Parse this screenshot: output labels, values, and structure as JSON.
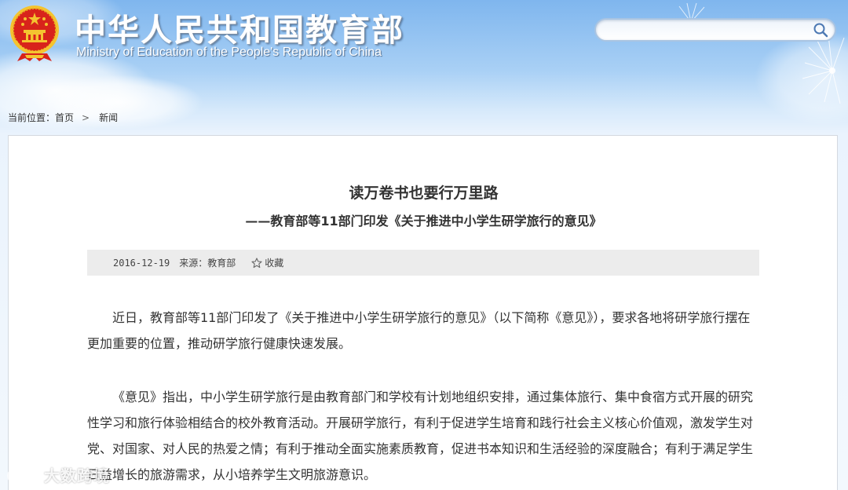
{
  "header": {
    "site_title": "中华人民共和国教育部",
    "site_subtitle": "Ministry of Education of the People's Republic of China",
    "search": {
      "value": "",
      "placeholder": ""
    }
  },
  "breadcrumb": {
    "prefix": "当前位置：",
    "home": "首页",
    "separator": ">",
    "current": "新闻"
  },
  "article": {
    "title": "读万卷书也要行万里路",
    "subtitle": "——教育部等11部门印发《关于推进中小学生研学旅行的意见》",
    "date": "2016-12-19",
    "source": "来源：教育部",
    "favorite_label": "收藏",
    "paragraphs": [
      "近日，教育部等11部门印发了《关于推进中小学生研学旅行的意见》（以下简称《意见》），要求各地将研学旅行摆在更加重要的位置，推动研学旅行健康快速发展。",
      "《意见》指出，中小学生研学旅行是由教育部门和学校有计划地组织安排，通过集体旅行、集中食宿方式开展的研究性学习和旅行体验相结合的校外教育活动。开展研学旅行，有利于促进学生培育和践行社会主义核心价值观，激发学生对党、对国家、对人民的热爱之情；有利于推动全面实施素质教育，促进书本知识和生活经验的深度融合；有利于满足学生日益增长的旅游需求，从小培养学生文明旅游意识。"
    ]
  },
  "watermark": {
    "text": "大数跨境"
  },
  "colors": {
    "header_sky": "#7fb6ee",
    "text": "#333333",
    "meta_bar": "#ececec",
    "panel_border": "#d4d9e0",
    "emblem_red": "#d8231b",
    "emblem_gold": "#f4c430"
  }
}
